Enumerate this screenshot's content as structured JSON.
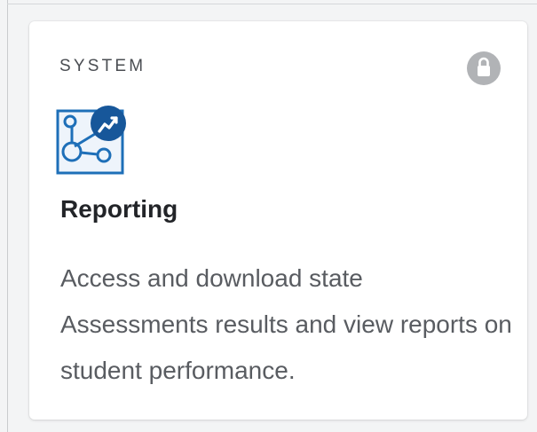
{
  "card": {
    "category": "SYSTEM",
    "title": "Reporting",
    "description": "Access and download state Assessments results and view reports on student performance.",
    "app_icon": "reporting-network-trend-icon",
    "lock_icon": "lock-icon"
  },
  "colors": {
    "background": "#f3f4f5",
    "card": "#ffffff",
    "category_text": "#4a4d52",
    "title_text": "#222428",
    "description_text": "#595c61",
    "lock_badge": "#b1b3b6",
    "icon_blue": "#1e6fb8",
    "icon_dark_blue": "#17579a"
  }
}
